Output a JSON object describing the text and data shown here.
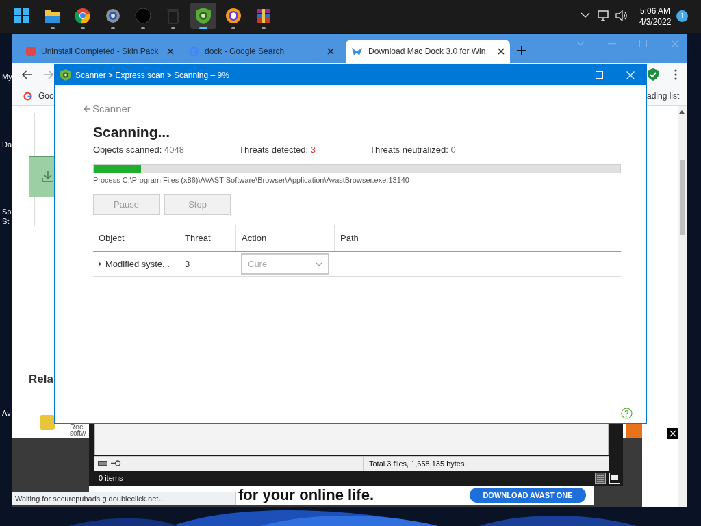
{
  "desktop": {
    "icon_labels": [
      "My",
      "Da",
      "Sp",
      "St",
      "Av"
    ]
  },
  "taskbar": {
    "apps": [
      {
        "selected": false
      },
      {
        "selected": false
      },
      {
        "selected": false
      },
      {
        "selected": false
      },
      {
        "selected": false
      },
      {
        "selected": false
      },
      {
        "selected": true
      },
      {
        "selected": false
      },
      {
        "selected": false
      }
    ],
    "time": "5:06 AM",
    "date": "4/3/2022",
    "notification_count": "1"
  },
  "browser": {
    "tabs": [
      {
        "title": "Uninstall Completed - Skin Pack",
        "selected": false
      },
      {
        "title": "dock - Google Search",
        "selected": false
      },
      {
        "title": "Download Mac Dock 3.0 for Win",
        "selected": true
      }
    ],
    "bookmark": "Goo",
    "reading_list": "ading list",
    "page": {
      "heading": "Rela",
      "item_title": "Roc",
      "item_subtitle": "softw"
    },
    "ad": {
      "headline": "for your online life.",
      "button": "DOWNLOAD AVAST ONE"
    },
    "status": "Waiting for securepubads.g.doubleclick.net..."
  },
  "scanner": {
    "title": "Scanner > Express scan > Scanning – 9%",
    "back": "Scanner",
    "heading": "Scanning...",
    "stats": [
      {
        "label": "Objects scanned:",
        "value": "4048",
        "alert": false
      },
      {
        "label": "Threats detected:",
        "value": "3",
        "alert": true
      },
      {
        "label": "Threats neutralized:",
        "value": "0",
        "alert": false
      }
    ],
    "progress": {
      "level": 0.09
    },
    "process": "Process C:\\Program Files (x86)\\AVAST Software\\Browser\\Application\\AvastBrowser.exe:13140",
    "buttons": [
      {
        "label": "Pause",
        "disabled": true
      },
      {
        "label": "Stop",
        "disabled": true
      }
    ],
    "table": {
      "columns": [
        "Object",
        "Threat",
        "Action",
        "Path"
      ],
      "rows": [
        {
          "object": "Modified syste...",
          "threat": "3",
          "action": "Cure",
          "action_disabled": true
        }
      ]
    }
  },
  "explorer": {
    "summary": "Total 3 files, 1,658,135 bytes",
    "items": "0 items"
  }
}
